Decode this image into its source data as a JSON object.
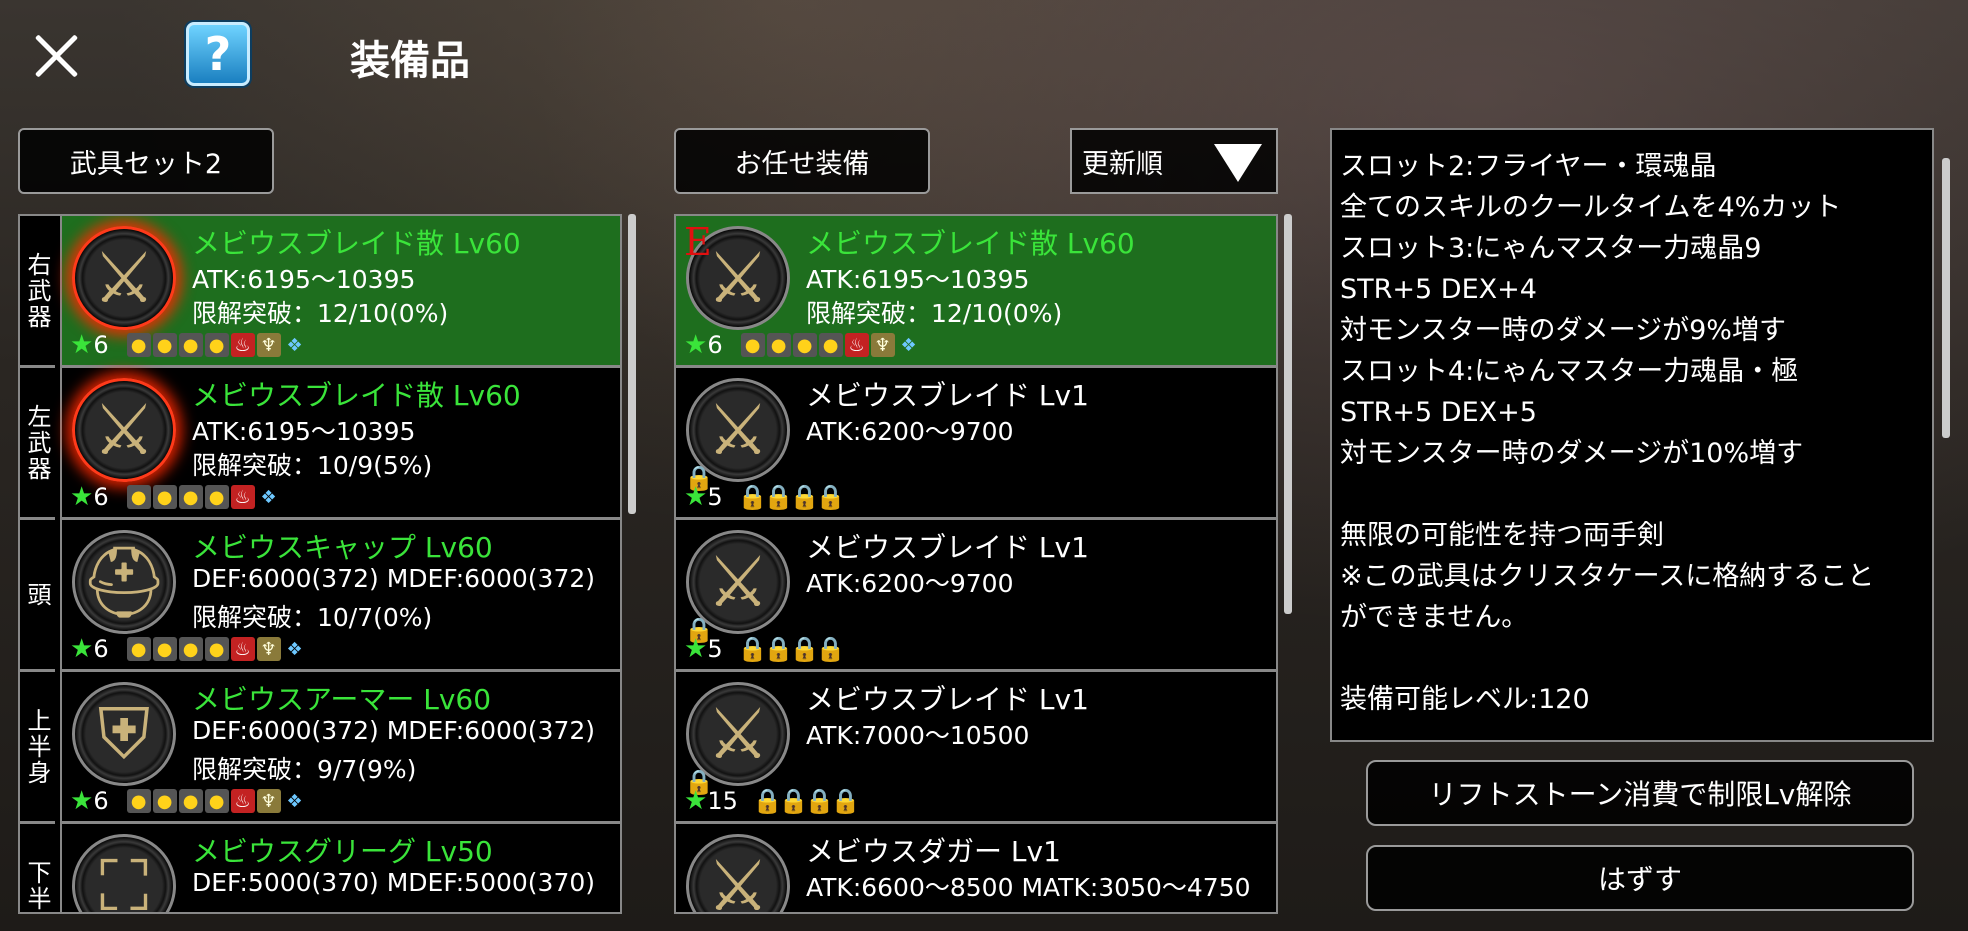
{
  "header": {
    "title": "装備品",
    "help_glyph": "?",
    "close_icon": "close-icon"
  },
  "controls": {
    "set_label": "武具セット2",
    "auto_label": "お任せ装備",
    "sort_value": "更新順"
  },
  "slots": [
    "右武器",
    "左武器",
    "頭",
    "上半身",
    "下半身"
  ],
  "equipped": [
    {
      "name": "メビウスブレイド散 Lv60",
      "line1": "ATK:6195～10395",
      "line2": "限解突破：12/10(0%)",
      "rarity": "6",
      "icon": "sword-icon",
      "gems": [
        "yellow",
        "yellow",
        "yellow",
        "yellow",
        "red",
        "tan",
        "blue"
      ]
    },
    {
      "name": "メビウスブレイド散 Lv60",
      "line1": "ATK:6195～10395",
      "line2": "限解突破：10/9(5%)",
      "rarity": "6",
      "icon": "sword-icon",
      "gems": [
        "yellow",
        "yellow",
        "yellow",
        "yellow",
        "red",
        "blue"
      ]
    },
    {
      "name": "メビウスキャップ Lv60",
      "line1": "DEF:6000(372) MDEF:6000(372)",
      "line2": "限解突破：10/7(0%)",
      "rarity": "6",
      "icon": "helmet-icon",
      "gems": [
        "yellow",
        "yellow",
        "yellow",
        "yellow",
        "red",
        "tan",
        "blue"
      ]
    },
    {
      "name": "メビウスアーマー Lv60",
      "line1": "DEF:6000(372) MDEF:6000(372)",
      "line2": "限解突破：9/7(9%)",
      "rarity": "6",
      "icon": "armor-icon",
      "gems": [
        "yellow",
        "yellow",
        "yellow",
        "yellow",
        "red",
        "tan",
        "blue"
      ]
    },
    {
      "name": "メビウスグリーグ Lv50",
      "line1": "DEF:5000(370) MDEF:5000(370)",
      "line2": "",
      "rarity": "",
      "icon": "greaves-icon",
      "gems": []
    }
  ],
  "inventory": [
    {
      "name": "メビウスブレイド散 Lv60",
      "line1": "ATK:6195～10395",
      "line2": "限解突破：12/10(0%)",
      "rarity": "6",
      "equipped_mark": "E",
      "locked": false,
      "gems": [
        "yellow",
        "yellow",
        "yellow",
        "yellow",
        "red",
        "tan",
        "blue"
      ]
    },
    {
      "name": "メビウスブレイド Lv1",
      "line1": "ATK:6200～9700",
      "line2": "",
      "rarity": "5",
      "equipped_mark": "",
      "locked": true,
      "gems": [
        "lock",
        "lock",
        "lock",
        "lock"
      ]
    },
    {
      "name": "メビウスブレイド Lv1",
      "line1": "ATK:6200～9700",
      "line2": "",
      "rarity": "5",
      "equipped_mark": "",
      "locked": true,
      "gems": [
        "lock",
        "lock",
        "lock",
        "lock"
      ]
    },
    {
      "name": "メビウスブレイド Lv1",
      "line1": "ATK:7000～10500",
      "line2": "",
      "rarity": "15",
      "equipped_mark": "",
      "locked": true,
      "gems": [
        "lock",
        "lock",
        "lock",
        "lock"
      ]
    },
    {
      "name": "メビウスダガー Lv1",
      "line1": "ATK:6600～8500 MATK:3050～4750",
      "line2": "",
      "rarity": "",
      "equipped_mark": "",
      "locked": false,
      "gems": []
    }
  ],
  "detail_lines": [
    "スロット2:フライヤー・環魂晶",
    "全てのスキルのクールタイムを4%カット",
    "スロット3:にゃんマスター力魂晶9",
    "STR+5 DEX+4",
    "対モンスター時のダメージが9%増す",
    "スロット4:にゃんマスター力魂晶・極",
    "STR+5 DEX+5",
    "対モンスター時のダメージが10%増す",
    "",
    "無限の可能性を持つ両手剣",
    "※この武具はクリスタケースに格納すること",
    "ができません。",
    "",
    "装備可能レベル:120"
  ],
  "actions": {
    "rift_label": "リフトストーン消費で制限Lv解除",
    "remove_label": "はずす"
  },
  "colors": {
    "name_green": "#3ae43a",
    "selected_bg": "#1e6e1e",
    "equip_mark_red": "#e01010",
    "glow_red": "#ff3a1a"
  }
}
